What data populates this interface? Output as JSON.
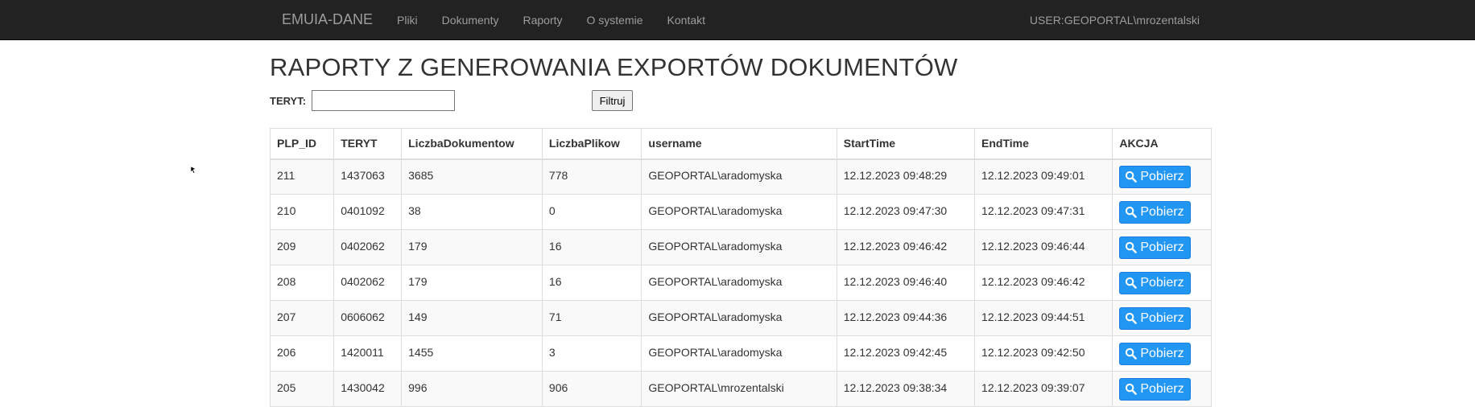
{
  "navbar": {
    "brand": "EMUIA-DANE",
    "links": [
      "Pliki",
      "Dokumenty",
      "Raporty",
      "O systemie",
      "Kontakt"
    ],
    "user": "USER:GEOPORTAL\\mrozentalski"
  },
  "page": {
    "title": "RAPORTY Z GENEROWANIA EXPORTÓW DOKUMENTÓW"
  },
  "filter": {
    "label": "TERYT:",
    "value": "",
    "button": "Filtruj"
  },
  "table": {
    "headers": [
      "PLP_ID",
      "TERYT",
      "LiczbaDokumentow",
      "LiczbaPlikow",
      "username",
      "StartTime",
      "EndTime",
      "AKCJA"
    ],
    "rows": [
      [
        "211",
        "1437063",
        "3685",
        "778",
        "GEOPORTAL\\aradomyska",
        "12.12.2023 09:48:29",
        "12.12.2023 09:49:01"
      ],
      [
        "210",
        "0401092",
        "38",
        "0",
        "GEOPORTAL\\aradomyska",
        "12.12.2023 09:47:30",
        "12.12.2023 09:47:31"
      ],
      [
        "209",
        "0402062",
        "179",
        "16",
        "GEOPORTAL\\aradomyska",
        "12.12.2023 09:46:42",
        "12.12.2023 09:46:44"
      ],
      [
        "208",
        "0402062",
        "179",
        "16",
        "GEOPORTAL\\aradomyska",
        "12.12.2023 09:46:40",
        "12.12.2023 09:46:42"
      ],
      [
        "207",
        "0606062",
        "149",
        "71",
        "GEOPORTAL\\aradomyska",
        "12.12.2023 09:44:36",
        "12.12.2023 09:44:51"
      ],
      [
        "206",
        "1420011",
        "1455",
        "3",
        "GEOPORTAL\\aradomyska",
        "12.12.2023 09:42:45",
        "12.12.2023 09:42:50"
      ],
      [
        "205",
        "1430042",
        "996",
        "906",
        "GEOPORTAL\\mrozentalski",
        "12.12.2023 09:38:34",
        "12.12.2023 09:39:07"
      ]
    ],
    "action_label": "Pobierz",
    "action_icon": "search-icon"
  },
  "colors": {
    "navbar_bg": "#222222",
    "nav_text": "#9d9d9d",
    "button_blue": "#2196f3"
  }
}
